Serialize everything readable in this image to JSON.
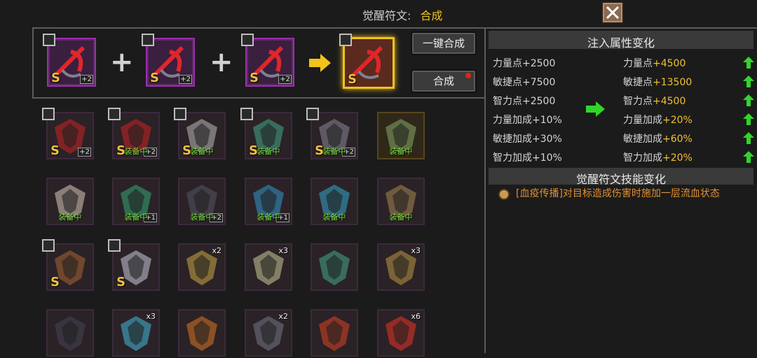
{
  "header": {
    "label": "觉醒符文:",
    "value": "合成"
  },
  "buttons": {
    "one_click": "一键合成",
    "synthesize": "合成"
  },
  "inputs": [
    {
      "grade": "S",
      "plus": "+2"
    },
    {
      "grade": "S",
      "plus": "+2"
    },
    {
      "grade": "S",
      "plus": "+2"
    }
  ],
  "result": {
    "grade": "S"
  },
  "inventory": [
    {
      "grade": "S",
      "plus": "+2",
      "equipped": ""
    },
    {
      "grade": "S",
      "plus": "+2",
      "equipped": "装备中"
    },
    {
      "grade": "S",
      "plus": "",
      "equipped": "装备中"
    },
    {
      "grade": "S",
      "plus": "",
      "equipped": "装备中"
    },
    {
      "grade": "S",
      "plus": "+2",
      "equipped": "装备中"
    },
    {
      "grade": "",
      "plus": "",
      "equipped": "装备中"
    },
    {
      "grade": "",
      "plus": "",
      "equipped": "装备中"
    },
    {
      "grade": "",
      "plus": "+1",
      "equipped": "装备中"
    },
    {
      "grade": "",
      "plus": "+2",
      "equipped": "装备中"
    },
    {
      "grade": "",
      "plus": "+1",
      "equipped": "装备中"
    },
    {
      "grade": "",
      "plus": "",
      "equipped": "装备中"
    },
    {
      "grade": "",
      "plus": "",
      "equipped": "装备中"
    },
    {
      "grade": "S",
      "count": ""
    },
    {
      "grade": "S",
      "count": ""
    },
    {
      "grade": "",
      "count": "x2"
    },
    {
      "grade": "",
      "count": "x3"
    },
    {
      "grade": "",
      "count": ""
    },
    {
      "grade": "",
      "count": "x3"
    },
    {
      "grade": "",
      "count": ""
    },
    {
      "grade": "",
      "count": "x3"
    },
    {
      "grade": "",
      "count": ""
    },
    {
      "grade": "",
      "count": "x2"
    },
    {
      "grade": "",
      "count": ""
    },
    {
      "grade": "",
      "count": "x6"
    }
  ],
  "attributes": {
    "title": "注入属性变化",
    "before": [
      {
        "name": "力量点",
        "value": "+2500"
      },
      {
        "name": "敏捷点",
        "value": "+7500"
      },
      {
        "name": "智力点",
        "value": "+2500"
      },
      {
        "name": "力量加成",
        "value": "+10%"
      },
      {
        "name": "敏捷加成",
        "value": "+30%"
      },
      {
        "name": "智力加成",
        "value": "+10%"
      }
    ],
    "after": [
      {
        "name": "力量点",
        "value": "+4500"
      },
      {
        "name": "敏捷点",
        "value": "+13500"
      },
      {
        "name": "智力点",
        "value": "+4500"
      },
      {
        "name": "力量加成",
        "value": "+20%"
      },
      {
        "name": "敏捷加成",
        "value": "+60%"
      },
      {
        "name": "智力加成",
        "value": "+20%"
      }
    ]
  },
  "skill": {
    "title": "觉醒符文技能变化",
    "text": "[血疫传播]对目标造成伤害时施加一层流血状态"
  },
  "colors": {
    "accent": "#f0c020",
    "equipped": "#7be040",
    "up_arrow": "#2fd629",
    "skill": "#e09030"
  }
}
